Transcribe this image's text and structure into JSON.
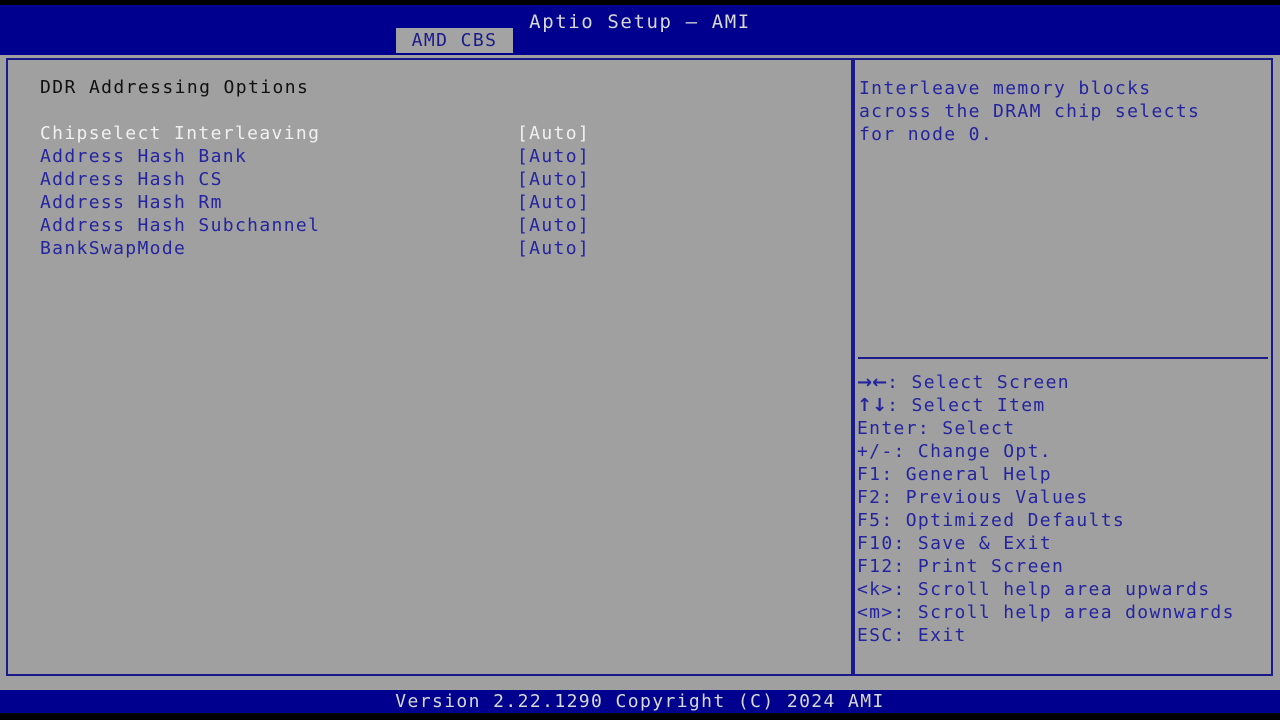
{
  "header": {
    "title": "Aptio Setup – AMI",
    "tabs": [
      {
        "label": "AMD CBS",
        "active": true
      }
    ]
  },
  "main": {
    "section_title": "DDR Addressing Options",
    "options": [
      {
        "label": "Chipselect Interleaving",
        "value": "[Auto]",
        "selected": true
      },
      {
        "label": "Address Hash Bank",
        "value": "[Auto]",
        "selected": false
      },
      {
        "label": "Address Hash CS",
        "value": "[Auto]",
        "selected": false
      },
      {
        "label": "Address Hash Rm",
        "value": "[Auto]",
        "selected": false
      },
      {
        "label": "Address Hash Subchannel",
        "value": "[Auto]",
        "selected": false
      },
      {
        "label": "BankSwapMode",
        "value": "[Auto]",
        "selected": false
      }
    ]
  },
  "help": {
    "description_lines": [
      "Interleave memory blocks",
      "across the DRAM chip selects",
      "for node 0."
    ],
    "keys": [
      {
        "glyph": "→←",
        "text": ": Select Screen"
      },
      {
        "glyph": "↑↓",
        "text": ": Select Item"
      },
      {
        "glyph": "",
        "text": "Enter: Select"
      },
      {
        "glyph": "",
        "text": "+/-: Change Opt."
      },
      {
        "glyph": "",
        "text": "F1: General Help"
      },
      {
        "glyph": "",
        "text": "F2: Previous Values"
      },
      {
        "glyph": "",
        "text": "F5: Optimized Defaults"
      },
      {
        "glyph": "",
        "text": "F10: Save & Exit"
      },
      {
        "glyph": "",
        "text": "F12: Print Screen"
      },
      {
        "glyph": "",
        "text": "<k>: Scroll help area upwards"
      },
      {
        "glyph": "",
        "text": "<m>: Scroll help area downwards"
      },
      {
        "glyph": "",
        "text": "ESC: Exit"
      }
    ]
  },
  "footer": {
    "version_text": "Version 2.22.1290 Copyright (C) 2024 AMI"
  },
  "colors": {
    "header_blue": "#00008e",
    "panel_bg": "#a0a0a0",
    "border_blue": "#1a1a8c",
    "text_blue": "#2424a0",
    "text_selected": "#f0f0f0",
    "title_text": "#d8d8d8",
    "section_title": "#101010"
  }
}
